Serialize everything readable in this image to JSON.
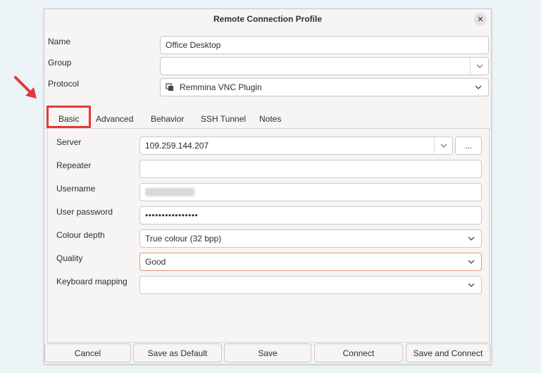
{
  "window": {
    "title": "Remote Connection Profile"
  },
  "profile": {
    "name_label": "Name",
    "name_value": "Office Desktop",
    "group_label": "Group",
    "group_value": "",
    "protocol_label": "Protocol",
    "protocol_value": "Remmina VNC Plugin"
  },
  "tabs": [
    {
      "label": "Basic",
      "active": true
    },
    {
      "label": "Advanced"
    },
    {
      "label": "Behavior"
    },
    {
      "label": "SSH Tunnel"
    },
    {
      "label": "Notes"
    }
  ],
  "basic": {
    "server_label": "Server",
    "server_value": "109.259.144.207",
    "server_browse": "...",
    "repeater_label": "Repeater",
    "repeater_value": "",
    "username_label": "Username",
    "password_label": "User password",
    "password_value": "••••••••••••••••",
    "colour_label": "Colour depth",
    "colour_value": "True colour (32 bpp)",
    "quality_label": "Quality",
    "quality_value": "Good",
    "keyboard_label": "Keyboard mapping",
    "keyboard_value": ""
  },
  "buttons": {
    "cancel": "Cancel",
    "save_default": "Save as Default",
    "save": "Save",
    "connect": "Connect",
    "save_connect": "Save and Connect"
  },
  "annotation": {
    "color": "#e53935",
    "icon": "arrow-icon"
  }
}
